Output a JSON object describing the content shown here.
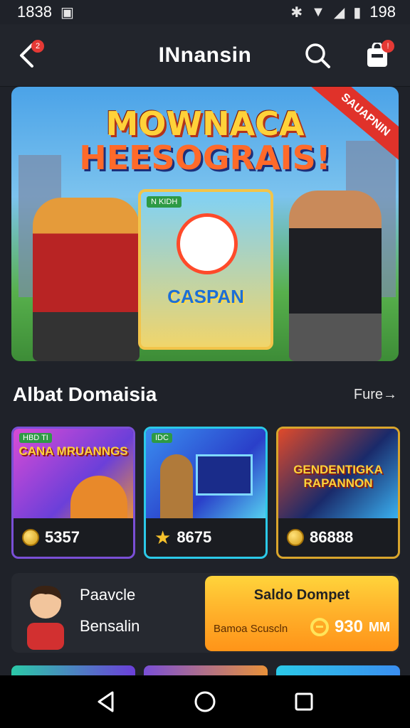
{
  "status_bar": {
    "time": "1838",
    "battery": "198"
  },
  "header": {
    "title": "INnansin",
    "back_badge": "2",
    "bag_badge": "!"
  },
  "banner": {
    "title_line1": "MOWNACA",
    "title_line2": "HEESOGRAIS!",
    "ribbon": "SAUAPNIN",
    "card_tag": "N KIDH",
    "card_title": "CASPAN"
  },
  "section": {
    "title": "Albat Domaisia",
    "see_more": "Fure"
  },
  "games": [
    {
      "tag": "HBD TI",
      "title": "CANA MRUANNGS",
      "price": "5357",
      "price_icon": "coin-icon",
      "border": "#7a4fd6"
    },
    {
      "tag": "IDC",
      "title": "",
      "price": "8675",
      "price_icon": "star-icon",
      "border": "#2bc9e8"
    },
    {
      "tag": "",
      "title": "GENDENTIGKA RAPANNON",
      "price": "86888",
      "price_icon": "coin-icon",
      "border": "#d9a52c"
    }
  ],
  "profile": {
    "name": "Paavcle",
    "sub": "Bensalin"
  },
  "wallet": {
    "title": "Saldo Dompet",
    "label": "Bamoa Scuscln",
    "amount": "930",
    "unit": "MM"
  },
  "colors": {
    "accent": "#ffb02a",
    "background": "#1f2229",
    "badge": "#e53935"
  }
}
